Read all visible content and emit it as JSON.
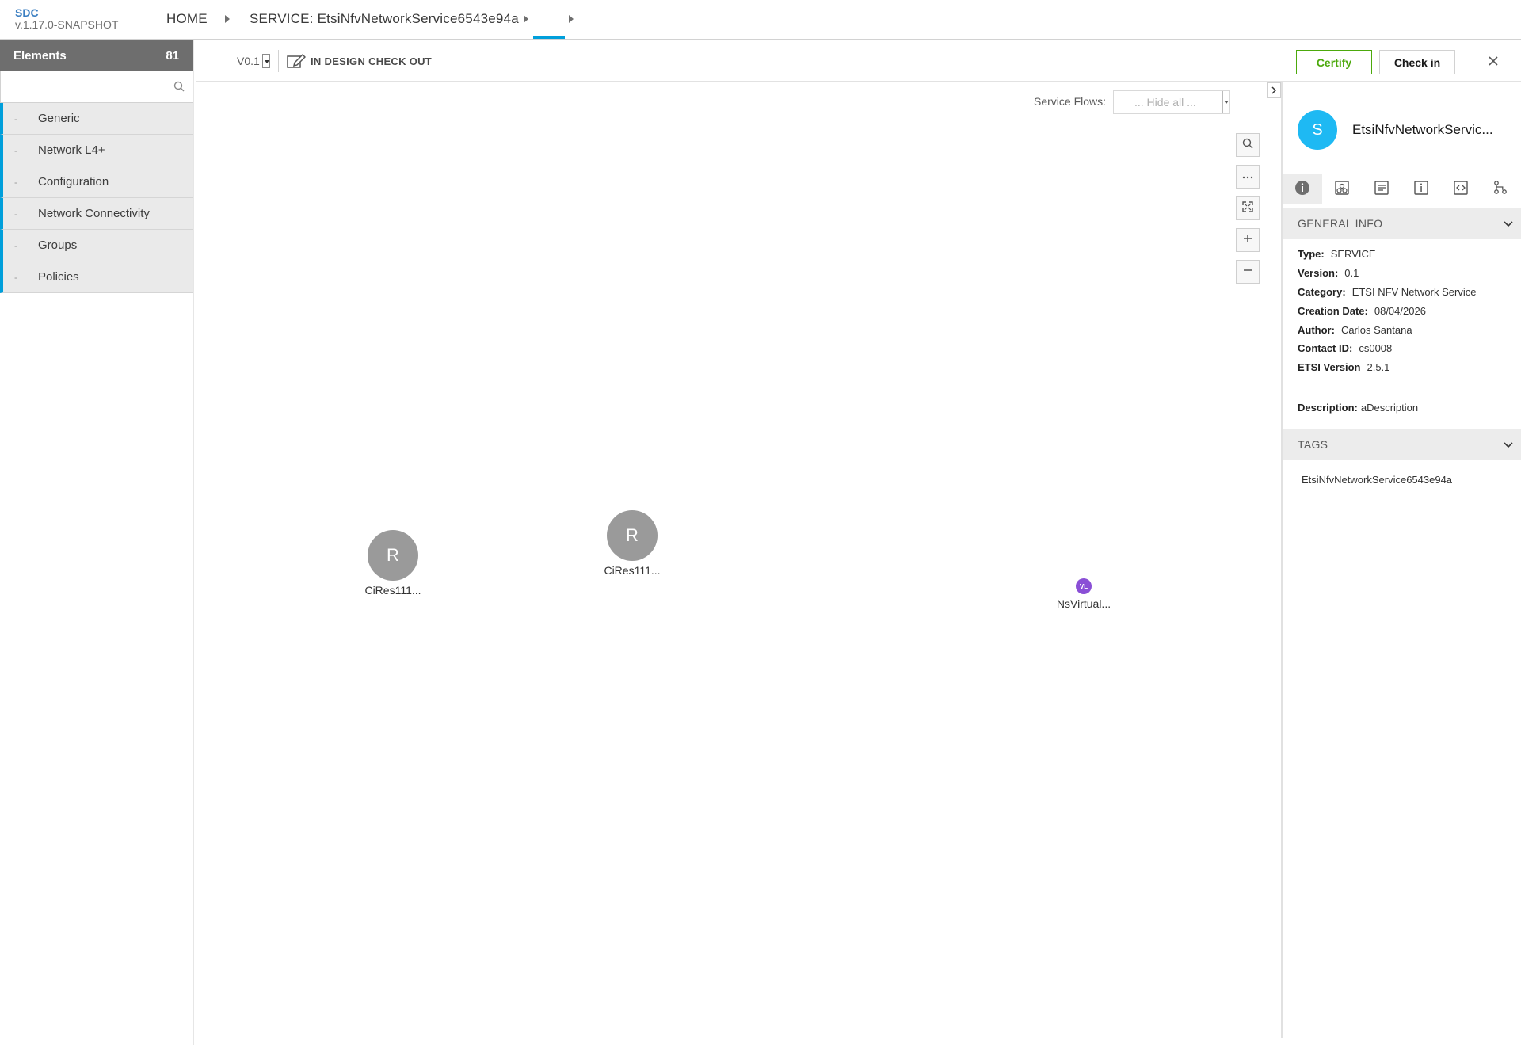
{
  "header": {
    "app_name": "SDC",
    "version": "v.1.17.0-SNAPSHOT",
    "breadcrumbs": [
      "HOME",
      "SERVICE: EtsiNfvNetworkService6543e94a",
      ""
    ]
  },
  "palette": {
    "title": "Elements",
    "count": "81",
    "search_placeholder": "",
    "categories": [
      {
        "dash": "-",
        "label": "Generic"
      },
      {
        "dash": "-",
        "label": "Network L4+"
      },
      {
        "dash": "-",
        "label": "Configuration"
      },
      {
        "dash": "-",
        "label": "Network Connectivity"
      },
      {
        "dash": "-",
        "label": "Groups"
      },
      {
        "dash": "-",
        "label": "Policies"
      }
    ]
  },
  "toolbar": {
    "version": "V0.1",
    "state": "IN DESIGN CHECK OUT",
    "certify_label": "Certify",
    "checkin_label": "Check in"
  },
  "canvas": {
    "service_flows_label": "Service Flows:",
    "service_flows_value": "... Hide all ...",
    "nodes": [
      {
        "icon_letter": "R",
        "name": "CiRes111..."
      },
      {
        "icon_letter": "R",
        "name": "CiRes111..."
      },
      {
        "icon_letter": "VL",
        "name": "NsVirtual..."
      }
    ]
  },
  "panel": {
    "avatar_letter": "S",
    "title": "EtsiNfvNetworkServic...",
    "general_info_title": "GENERAL INFO",
    "info": [
      {
        "key": "Type:",
        "value": "SERVICE"
      },
      {
        "key": "Version:",
        "value": "0.1"
      },
      {
        "key": "Category:",
        "value": "ETSI NFV Network Service"
      },
      {
        "key": "Creation Date:",
        "value": "08/04/2026"
      },
      {
        "key": "Author:",
        "value": "Carlos Santana"
      },
      {
        "key": "Contact ID:",
        "value": "cs0008"
      },
      {
        "key": "ETSI Version",
        "value": "2.5.1"
      }
    ],
    "description_key": "Description:",
    "description_value": "aDescription",
    "tags_title": "TAGS",
    "tags": [
      "EtsiNfvNetworkService6543e94a"
    ]
  },
  "colors": {
    "accent": "#009fdb",
    "certify": "#4ca90c",
    "avatar": "#1eb9f3",
    "node_gray": "#9a9a9a",
    "vl_purple": "#8a4fd6"
  }
}
